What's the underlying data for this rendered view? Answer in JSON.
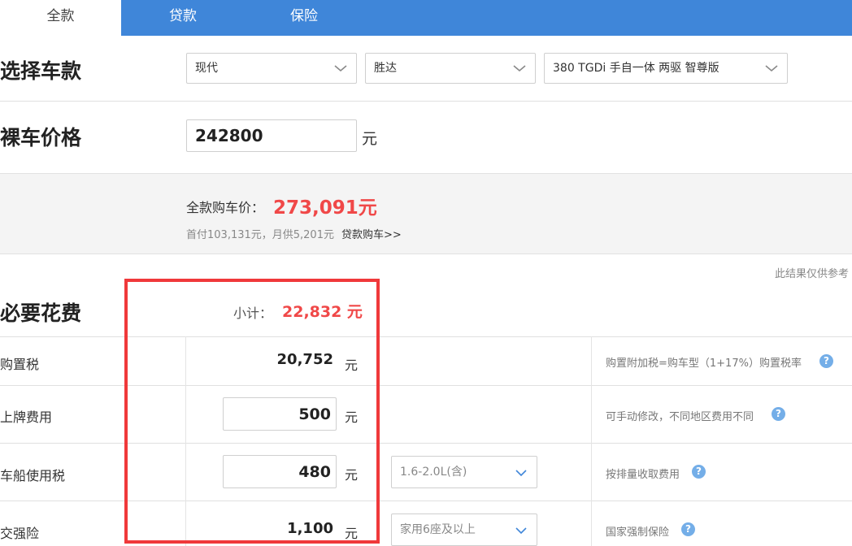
{
  "tabs": [
    {
      "label": "全款"
    },
    {
      "label": "贷款"
    },
    {
      "label": "保险"
    }
  ],
  "select_car": {
    "title": "选择车款",
    "brand": "现代",
    "series": "胜达",
    "model": "380 TGDi 手自一体 两驱 智尊版"
  },
  "bare_price": {
    "title": "裸车价格",
    "value": "242800",
    "unit": "元"
  },
  "summary": {
    "total_label": "全款购车价：",
    "total_value": "273,091元",
    "loan_hint": "首付103,131元，月供5,201元",
    "loan_link": "贷款购车>>"
  },
  "disclaimer": "此结果仅供参考",
  "required_fees": {
    "title": "必要花费",
    "subtotal_label": "小计：",
    "subtotal_value": "22,832 元",
    "rows": [
      {
        "label": "购置税",
        "value": "20,752",
        "unit": "元",
        "note": "购置附加税=购车型（1+17%）购置税率"
      },
      {
        "label": "上牌费用",
        "value": "500",
        "unit": "元",
        "note": "可手动修改，不同地区费用不同"
      },
      {
        "label": "车船使用税",
        "value": "480",
        "unit": "元",
        "option": "1.6-2.0L(含)",
        "note": "按排量收取费用"
      },
      {
        "label": "交强险",
        "value": "1,100",
        "unit": "元",
        "option": "家用6座及以上",
        "note": "国家强制保险"
      }
    ]
  },
  "colors": {
    "tab_bar": "#3f86d9",
    "accent_red": "#f04848",
    "highlight_border": "#f0393b",
    "help_icon": "#74aee8"
  }
}
